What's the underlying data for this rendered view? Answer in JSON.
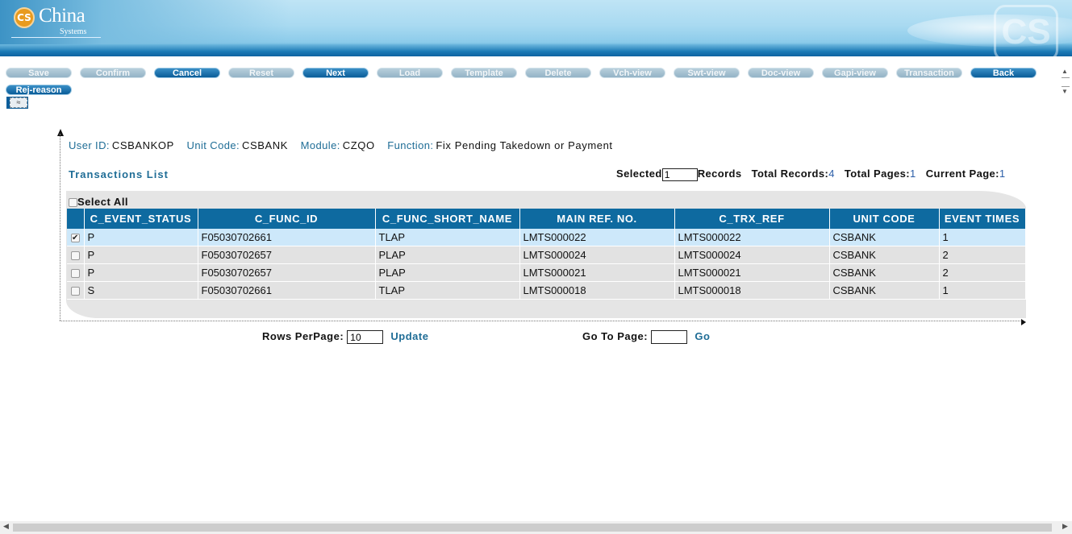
{
  "header": {
    "logo_mark": "CS",
    "logo_name": "China",
    "logo_sub": "Systems"
  },
  "toolbar": {
    "buttons": [
      {
        "label": "Save",
        "state": "disabled"
      },
      {
        "label": "Confirm",
        "state": "disabled"
      },
      {
        "label": "Cancel",
        "state": "enabled"
      },
      {
        "label": "Reset",
        "state": "disabled"
      },
      {
        "label": "Next",
        "state": "enabled"
      },
      {
        "label": "Load",
        "state": "disabled"
      },
      {
        "label": "Template",
        "state": "disabled"
      },
      {
        "label": "Delete",
        "state": "disabled"
      },
      {
        "label": "Vch-view",
        "state": "disabled"
      },
      {
        "label": "Swt-view",
        "state": "disabled"
      },
      {
        "label": "Doc-view",
        "state": "disabled"
      },
      {
        "label": "Gapi-view",
        "state": "disabled"
      },
      {
        "label": "Transaction",
        "state": "disabled"
      },
      {
        "label": "Back",
        "state": "enabled"
      },
      {
        "label": "Rej-reason",
        "state": "enabled"
      }
    ],
    "collapse_glyph": "≈"
  },
  "info": {
    "user_id_label": "User ID:",
    "user_id": "CSBANKOP",
    "unit_code_label": "Unit Code:",
    "unit_code": "CSBANK",
    "module_label": "Module:",
    "module": "CZQO",
    "function_label": "Function:",
    "function": "Fix Pending Takedown or Payment"
  },
  "list": {
    "title": "Transactions List",
    "selected_label": "Selected",
    "selected_value": "1",
    "records_label": "Records",
    "total_records_label": "Total Records:",
    "total_records": "4",
    "total_pages_label": "Total Pages:",
    "total_pages": "1",
    "current_page_label": "Current Page:",
    "current_page": "1",
    "select_all_label": "Select All",
    "columns": [
      "C_EVENT_STATUS",
      "C_FUNC_ID",
      "C_FUNC_SHORT_NAME",
      "MAIN REF. NO.",
      "C_TRX_REF",
      "UNIT CODE",
      "EVENT TIMES"
    ],
    "rows": [
      {
        "checked": true,
        "cells": [
          "P",
          "F05030702661",
          "TLAP",
          "LMTS000022",
          "LMTS000022",
          "CSBANK",
          "1"
        ]
      },
      {
        "checked": false,
        "cells": [
          "P",
          "F05030702657",
          "PLAP",
          "LMTS000024",
          "LMTS000024",
          "CSBANK",
          "2"
        ]
      },
      {
        "checked": false,
        "cells": [
          "P",
          "F05030702657",
          "PLAP",
          "LMTS000021",
          "LMTS000021",
          "CSBANK",
          "2"
        ]
      },
      {
        "checked": false,
        "cells": [
          "S",
          "F05030702661",
          "TLAP",
          "LMTS000018",
          "LMTS000018",
          "CSBANK",
          "1"
        ]
      }
    ]
  },
  "pager": {
    "rows_per_page_label": "Rows PerPage:",
    "rows_per_page": "10",
    "update_label": "Update",
    "goto_label": "Go To Page:",
    "goto_value": "",
    "go_label": "Go"
  },
  "colors": {
    "header_blue": "#0e6aa0",
    "label_blue": "#1f6d96",
    "selected_row": "#cde8fa",
    "row_bg": "#e2e2e2"
  }
}
